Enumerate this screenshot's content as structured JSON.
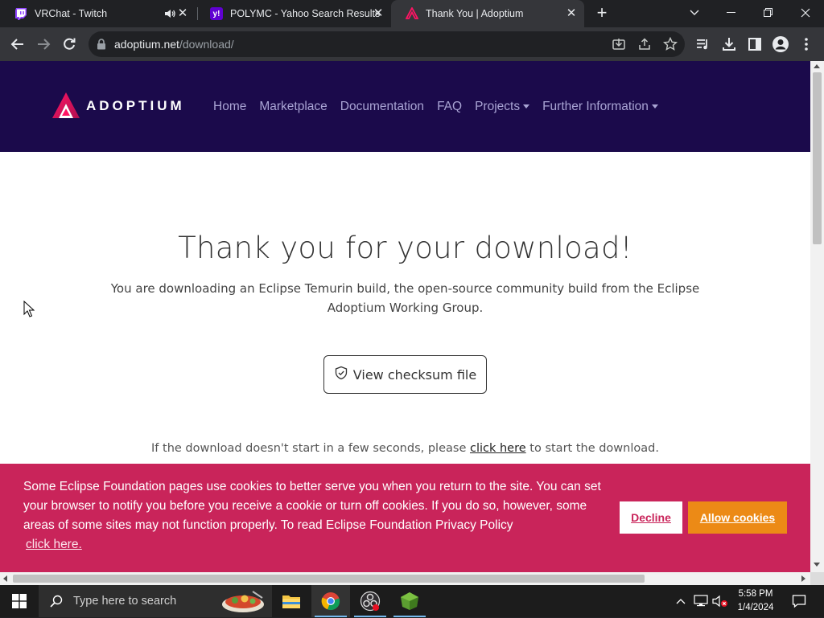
{
  "browser": {
    "tabs": [
      {
        "title": "VRChat - Twitch",
        "favicon": "twitch-icon",
        "audio": true
      },
      {
        "title": "POLYMC - Yahoo Search Results",
        "favicon": "yahoo-icon"
      },
      {
        "title": "Thank You | Adoptium",
        "favicon": "adoptium-icon",
        "active": true
      }
    ],
    "url_host": "adoptium.net",
    "url_path": "/download/"
  },
  "site": {
    "brand": "ADOPTIUM",
    "nav": [
      {
        "label": "Home"
      },
      {
        "label": "Marketplace"
      },
      {
        "label": "Documentation"
      },
      {
        "label": "FAQ"
      },
      {
        "label": "Projects",
        "dropdown": true
      },
      {
        "label": "Further Information",
        "dropdown": true
      }
    ],
    "nav_color": "#1b0a4b"
  },
  "main": {
    "title": "Thank you for your download!",
    "subtitle": "You are downloading an Eclipse Temurin build, the open-source community build from the Eclipse Adoptium Working Group.",
    "checksum_button": "View checksum file",
    "download_note_before": "If the download doesn't start in a few seconds, please ",
    "download_note_link": "click here",
    "download_note_after": " to start the download."
  },
  "cookie_banner": {
    "text": "Some Eclipse Foundation pages use cookies to better serve you when you return to the site. You can set your browser to notify you before you receive a cookie or turn off cookies. If you do so, however, some areas of some sites may not function properly. To read Eclipse Foundation Privacy Policy",
    "link": "click here.",
    "decline": "Decline",
    "allow": "Allow cookies",
    "colors": {
      "background": "#c9245a",
      "allow": "#ec8a16"
    }
  },
  "taskbar": {
    "search_placeholder": "Type here to search",
    "time": "5:58 PM",
    "date": "1/4/2024",
    "apps": [
      "file-explorer-icon",
      "chrome-icon",
      "obs-icon",
      "minecraft-icon"
    ]
  }
}
